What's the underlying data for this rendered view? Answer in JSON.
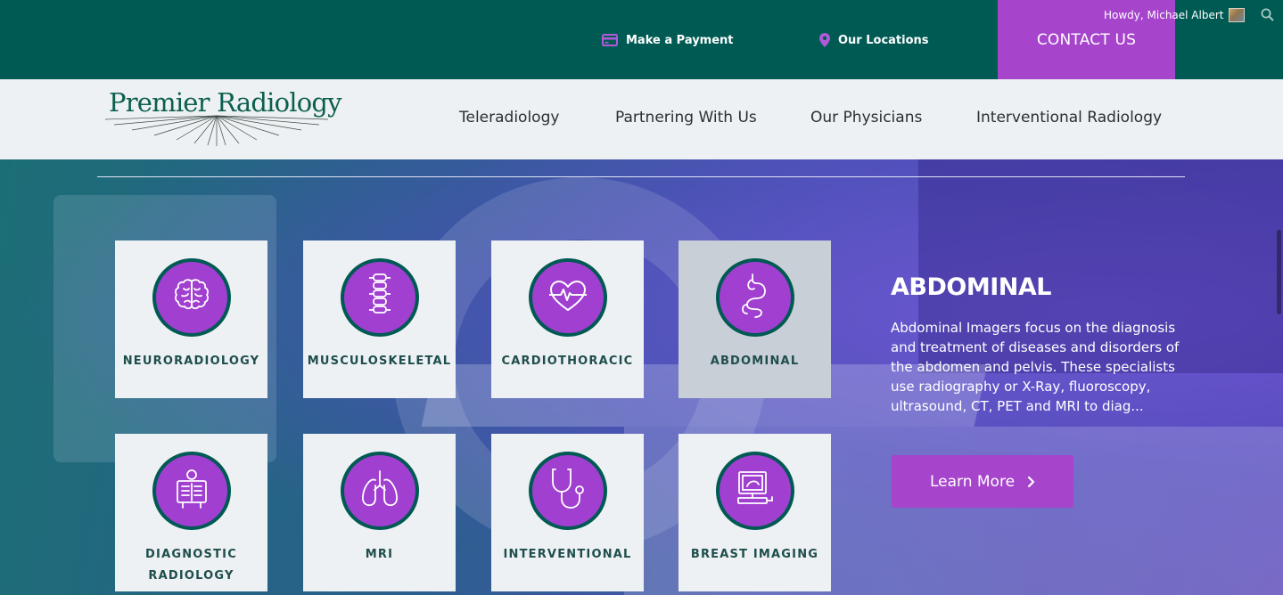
{
  "topbar": {
    "payment_label": "Make a Payment",
    "locations_label": "Our Locations",
    "contact_label": "CONTACT US",
    "greeting": "Howdy, Michael Albert"
  },
  "logo": {
    "text": "Premier Radiology"
  },
  "nav": {
    "items": [
      {
        "label": "Teleradiology"
      },
      {
        "label": "Partnering With Us"
      },
      {
        "label": "Our Physicians"
      },
      {
        "label": "Interventional Radiology"
      }
    ]
  },
  "specialties": {
    "active": "ABDOMINAL",
    "tiles": [
      {
        "label": "NEURORADIOLOGY",
        "icon": "brain-icon"
      },
      {
        "label": "MUSCULOSKELETAL",
        "icon": "spine-icon"
      },
      {
        "label": "CARDIOTHORACIC",
        "icon": "heart-icon"
      },
      {
        "label": "ABDOMINAL",
        "icon": "stomach-icon"
      },
      {
        "label": "DIAGNOSTIC RADIOLOGY",
        "icon": "xray-icon"
      },
      {
        "label": "MRI",
        "icon": "lungs-icon"
      },
      {
        "label": "INTERVENTIONAL",
        "icon": "stethoscope-icon"
      },
      {
        "label": "BREAST IMAGING",
        "icon": "ultrasound-icon"
      }
    ]
  },
  "panel": {
    "title": "ABDOMINAL",
    "description": "Abdominal Imagers focus on the diagnosis and treatment of diseases and disorders of the abdomen and pelvis. These specialists use radiography or X-Ray, fluoroscopy, ultrasound, CT, PET and MRI to diag...",
    "button_label": "Learn More"
  },
  "colors": {
    "brand_teal": "#005a54",
    "accent_purple": "#a644cc",
    "tile_bg": "#eef1f3",
    "tile_active_bg": "#c9cfd6"
  }
}
